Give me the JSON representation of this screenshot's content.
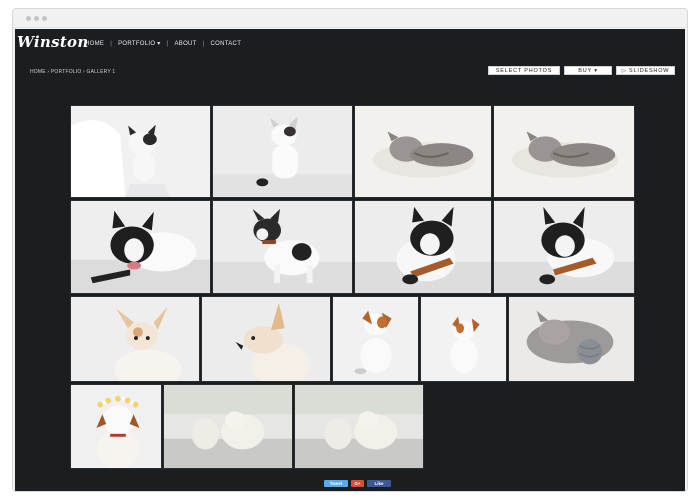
{
  "site": {
    "logo": "Winston",
    "nav": [
      {
        "label": "HOME"
      },
      {
        "label": "PORTFOLIO ▾"
      },
      {
        "label": "ABOUT"
      },
      {
        "label": "CONTACT"
      }
    ],
    "breadcrumb": "HOME › PORTFOLIO › GALLERY 1"
  },
  "actions": {
    "select_label": "SELECT PHOTOS",
    "buy_label": "BUY ▾",
    "slideshow_label": "▷ SLIDESHOW"
  },
  "gallery": {
    "photos": [
      {
        "subject": "kitten white-black on white fabric",
        "icon": "cat-photo"
      },
      {
        "subject": "kitten white sitting",
        "icon": "cat-photo"
      },
      {
        "subject": "tabby kitten sleeping",
        "icon": "cat-photo"
      },
      {
        "subject": "tabby kitten sleeping",
        "icon": "cat-photo"
      },
      {
        "subject": "french bulldog lying",
        "icon": "dog-photo"
      },
      {
        "subject": "french bulldog sitting",
        "icon": "dog-photo"
      },
      {
        "subject": "french bulldog chewing",
        "icon": "dog-photo"
      },
      {
        "subject": "french bulldog chewing",
        "icon": "dog-photo"
      },
      {
        "subject": "chihuahua",
        "icon": "dog-photo"
      },
      {
        "subject": "chihuahua side",
        "icon": "dog-photo"
      },
      {
        "subject": "jack russell puppy",
        "icon": "dog-photo"
      },
      {
        "subject": "jack russell puppy",
        "icon": "dog-photo"
      },
      {
        "subject": "kitten with yarn ball",
        "icon": "cat-photo"
      },
      {
        "subject": "puppy with flower crown",
        "icon": "dog-photo"
      },
      {
        "subject": "two white puppies",
        "icon": "dog-photo"
      },
      {
        "subject": "two white puppies",
        "icon": "dog-photo"
      }
    ]
  },
  "share": {
    "tweet": "Tweet",
    "gplus": "G+",
    "like": "Like"
  },
  "colors": {
    "background": "#1b1e20",
    "text": "#e6e6e6"
  }
}
